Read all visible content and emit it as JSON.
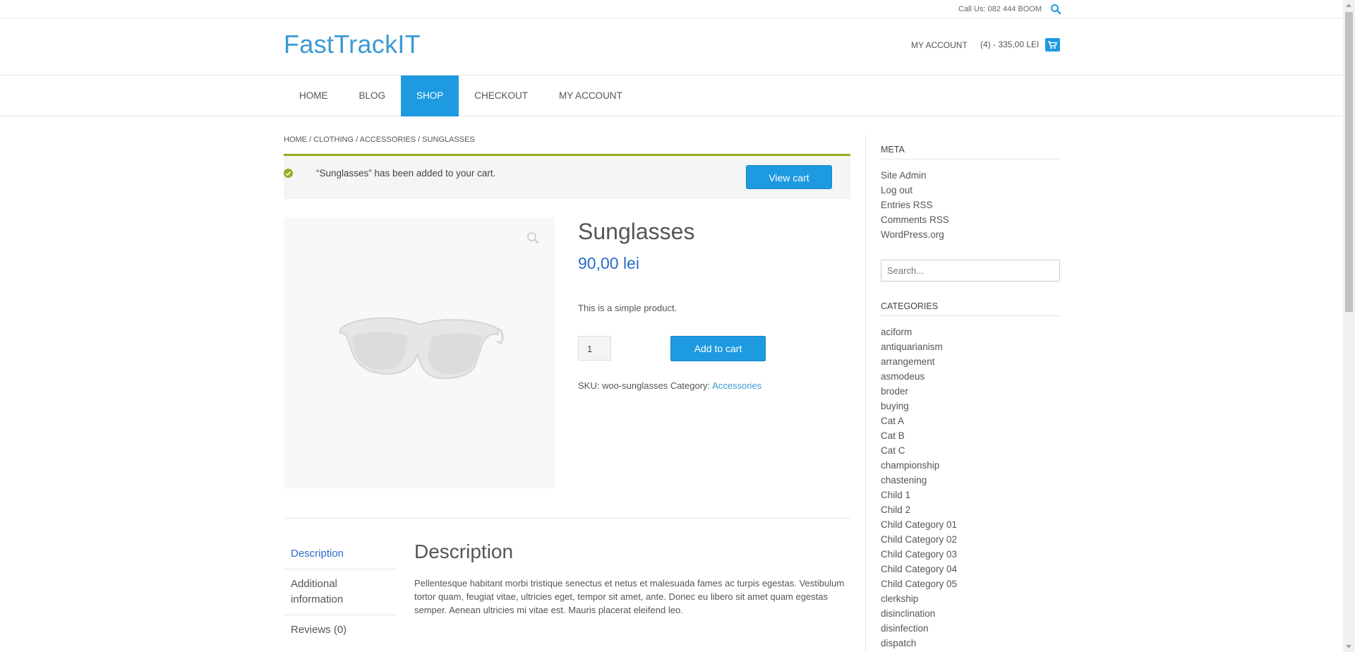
{
  "topbar": {
    "call_text": "Call Us: 082 444 BOOM",
    "search_icon": "search-icon"
  },
  "header": {
    "logo": "FastTrackIT",
    "my_account": "MY ACCOUNT",
    "cart_summary": "(4) - 335,00 LEI",
    "cart_icon": "cart-icon"
  },
  "nav": {
    "items": [
      {
        "label": "HOME",
        "active": false
      },
      {
        "label": "BLOG",
        "active": false
      },
      {
        "label": "SHOP",
        "active": true
      },
      {
        "label": "CHECKOUT",
        "active": false
      },
      {
        "label": "MY ACCOUNT",
        "active": false
      }
    ]
  },
  "breadcrumb": {
    "items": [
      "HOME",
      "CLOTHING",
      "ACCESSORIES",
      "SUNGLASSES"
    ],
    "separator": " / "
  },
  "notice": {
    "message": "“Sunglasses” has been added to your cart.",
    "view_cart_label": "View cart"
  },
  "product": {
    "title": "Sunglasses",
    "price": "90,00 lei",
    "short_description": "This is a simple product.",
    "quantity": "1",
    "add_to_cart_label": "Add to cart",
    "sku_label": "SKU:",
    "sku": "woo-sunglasses",
    "category_label": "Category:",
    "category": "Accessories",
    "image_icon": "sunglasses-image",
    "zoom_icon": "zoom-icon"
  },
  "tabs": {
    "items": [
      {
        "label": "Description",
        "active": true
      },
      {
        "label": "Additional information",
        "active": false
      },
      {
        "label": "Reviews (0)",
        "active": false
      }
    ]
  },
  "description": {
    "title": "Description",
    "text": "Pellentesque habitant morbi tristique senectus et netus et malesuada fames ac turpis egestas. Vestibulum tortor quam, feugiat vitae, ultricies eget, tempor sit amet, ante. Donec eu libero sit amet quam egestas semper. Aenean ultricies mi vitae est. Mauris placerat eleifend leo."
  },
  "sidebar": {
    "meta_title": "META",
    "meta_items": [
      "Site Admin",
      "Log out",
      "Entries RSS",
      "Comments RSS",
      "WordPress.org"
    ],
    "search_placeholder": "Search...",
    "categories_title": "CATEGORIES",
    "categories": [
      "aciform",
      "antiquarianism",
      "arrangement",
      "asmodeus",
      "broder",
      "buying",
      "Cat A",
      "Cat B",
      "Cat C",
      "championship",
      "chastening",
      "Child 1",
      "Child 2",
      "Child Category 01",
      "Child Category 02",
      "Child Category 03",
      "Child Category 04",
      "Child Category 05",
      "clerkship",
      "disinclination",
      "disinfection",
      "dispatch"
    ]
  },
  "colors": {
    "accent": "#1e9ae0",
    "logo": "#3a9bd5",
    "price": "#2b6cc8",
    "notice_border": "#8fae1b"
  }
}
